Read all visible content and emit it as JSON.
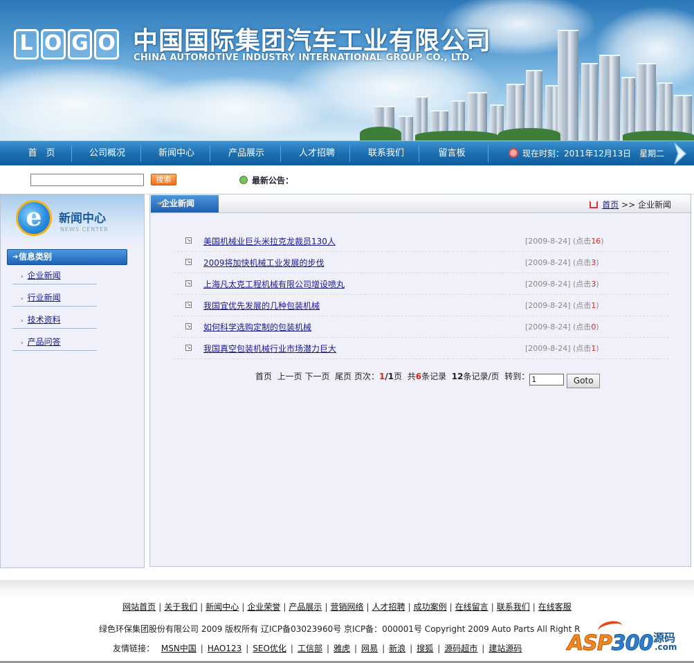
{
  "header": {
    "logo_text": "LOGO",
    "company_cn": "中国国际集团汽车工业有限公司",
    "company_en": "CHINA AUTOMOTIVE INDUSTRY INTERNATIONAL GROUP CO., LTD."
  },
  "nav": {
    "items": [
      "首　页",
      "公司概况",
      "新闻中心",
      "产品展示",
      "人才招聘",
      "联系我们",
      "留言板"
    ],
    "time_label": "现在时刻：2011年12月13日　星期二"
  },
  "search": {
    "input_value": "",
    "button_label": "搜索",
    "notice_label": "最新公告："
  },
  "sidebar": {
    "title": "新闻中心",
    "subtitle": "NEWS CENTER",
    "category_header": "信息类别",
    "links": [
      "企业新闻",
      "行业新闻",
      "技术资料",
      "产品问答"
    ]
  },
  "main": {
    "tab_label": "企业新闻",
    "breadcrumb_home": "首页",
    "breadcrumb_sep": ">>",
    "breadcrumb_current": "企业新闻",
    "news": [
      {
        "title": "美国机械业巨头米拉克龙裁员130人",
        "date": "[2009-8-24]",
        "hits_label": "(点击",
        "hits": "16",
        "hits_end": ")"
      },
      {
        "title": "2009将加快机械工业发展的步伐",
        "date": "[2009-8-24]",
        "hits_label": "(点击",
        "hits": "3",
        "hits_end": ")"
      },
      {
        "title": "上海凡太克工程机械有限公司增设喷丸",
        "date": "[2009-8-24]",
        "hits_label": "(点击",
        "hits": "3",
        "hits_end": ")"
      },
      {
        "title": "我国宜优先发展的几种包装机械",
        "date": "[2009-8-24]",
        "hits_label": "(点击",
        "hits": "1",
        "hits_end": ")"
      },
      {
        "title": "如何科学选购定制的包装机械",
        "date": "[2009-8-24]",
        "hits_label": "(点击",
        "hits": "0",
        "hits_end": ")"
      },
      {
        "title": "我国真空包装机械行业市场潜力巨大",
        "date": "[2009-8-24]",
        "hits_label": "(点击",
        "hits": "1",
        "hits_end": ")"
      }
    ],
    "pager": {
      "first": "首页",
      "prev": "上一页",
      "next": "下一页",
      "last": "尾页",
      "page_label": "页次：",
      "current": "1",
      "total_pages": "/1",
      "page_unit": "页",
      "total_prefix": "共",
      "total_records": "6",
      "total_suffix": "条记录",
      "per_page": "12",
      "per_page_suffix": "条记录/页",
      "goto_label": "转到：",
      "goto_value": "1",
      "goto_button": "Goto"
    }
  },
  "footer": {
    "links": [
      "网站首页",
      "关于我们",
      "新闻中心",
      "企业荣誉",
      "产品展示",
      "营销网络",
      "人才招聘",
      "成功案例",
      "在线留言",
      "联系我们",
      "在线客服"
    ],
    "copyright": "绿色环保集团股份有限公司  2009 版权所有  辽ICP备03023960号  京ICP备：000001号  Copyright 2009 Auto Parts All Right R",
    "friends_label": "友情链接：",
    "friends": [
      "MSN中国",
      "HAO123",
      "SEO优化",
      "工信部",
      "雅虎",
      "网易",
      "新浪",
      "搜狐",
      "源码超市",
      "建站源码"
    ],
    "watermark": {
      "brand_a": "ASP",
      "brand_b": "300",
      "cn": "源码",
      "com": ".com"
    }
  }
}
